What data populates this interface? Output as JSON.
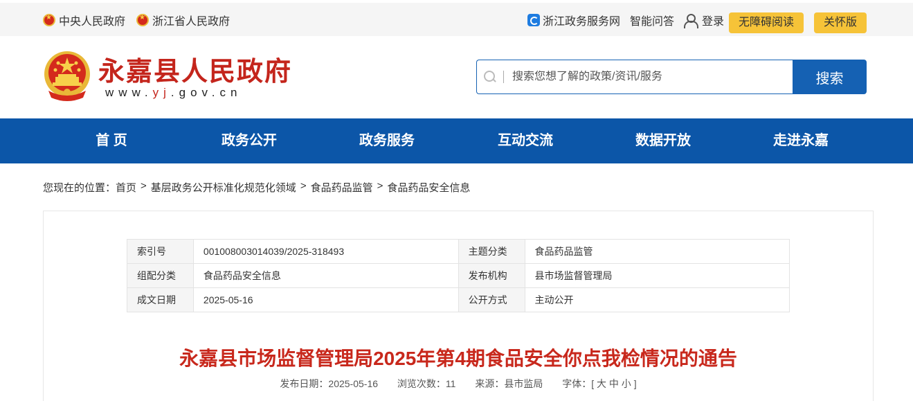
{
  "topbar": {
    "central_gov": "中央人民政府",
    "provincial_gov": "浙江省人民政府",
    "zj_service": "浙江政务服务网",
    "smart_qa": "智能问答",
    "login": "登录",
    "accessible": "无障碍阅读",
    "care_mode": "关怀版"
  },
  "header": {
    "site_name": "永嘉县人民政府",
    "url_prefix": "www.",
    "url_highlight": "yj",
    "url_suffix": ".gov.cn",
    "search_placeholder": "搜索您想了解的政策/资讯/服务",
    "search_button": "搜索"
  },
  "nav": {
    "items": [
      "首 页",
      "政务公开",
      "政务服务",
      "互动交流",
      "数据开放",
      "走进永嘉"
    ]
  },
  "breadcrumb": {
    "prefix": "您现在的位置：",
    "items": [
      "首页",
      "基层政务公开标准化规范化领域",
      "食品药品监管",
      "食品药品安全信息"
    ],
    "separator": ">"
  },
  "meta": {
    "rows": [
      {
        "k1": "索引号",
        "v1": "001008003014039/2025-318493",
        "k2": "主题分类",
        "v2": "食品药品监管"
      },
      {
        "k1": "组配分类",
        "v1": "食品药品安全信息",
        "k2": "发布机构",
        "v2": "县市场监督管理局"
      },
      {
        "k1": "成文日期",
        "v1": "2025-05-16",
        "k2": "公开方式",
        "v2": "主动公开"
      }
    ]
  },
  "article": {
    "title": "永嘉县市场监督管理局2025年第4期食品安全你点我检情况的通告",
    "publish_date": "发布日期：2025-05-16",
    "views": "浏览次数：11",
    "source": "来源：县市监局",
    "font_size": "字体：[ 大 中 小 ]"
  },
  "colors": {
    "brand_red": "#c4251c",
    "nav_blue": "#0c56a8",
    "pill_yellow": "#f6c338"
  }
}
